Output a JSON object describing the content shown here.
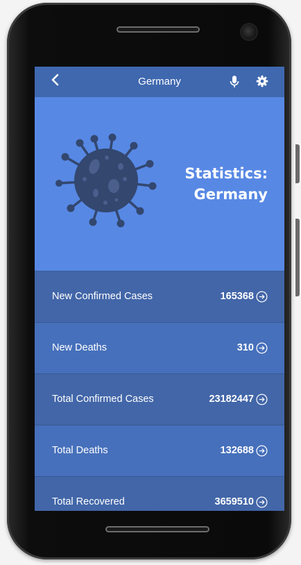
{
  "appbar": {
    "title": "Germany",
    "back_icon": "chevron-left-icon",
    "mic_icon": "microphone-icon",
    "settings_icon": "gear-icon"
  },
  "hero": {
    "title_line1": "Statistics:",
    "title_line2": "Germany",
    "image_icon": "virus-icon"
  },
  "stats": [
    {
      "label": "New Confirmed Cases",
      "value": "165368"
    },
    {
      "label": "New Deaths",
      "value": "310"
    },
    {
      "label": "Total Confirmed Cases",
      "value": "23182447"
    },
    {
      "label": "Total Deaths",
      "value": "132688"
    },
    {
      "label": "Total Recovered",
      "value": "3659510"
    }
  ],
  "colors": {
    "appbar": "#3f68af",
    "hero": "#5788e4",
    "row_dark": "#4266a8",
    "row_light": "#4670bb",
    "virus": "#33476f"
  }
}
